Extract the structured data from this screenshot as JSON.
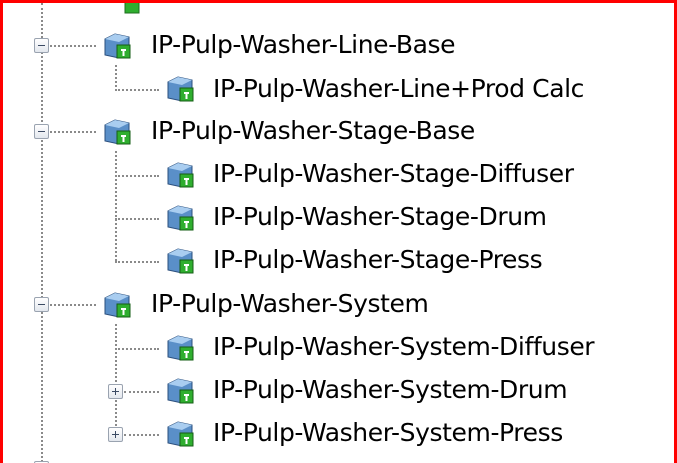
{
  "tree": {
    "nodes": [
      {
        "label": "IP-Pulp-Washer-Line-Base",
        "level": 1,
        "expander": "collapse"
      },
      {
        "label": "IP-Pulp-Washer-Line+Prod Calc",
        "level": 2,
        "expander": "none"
      },
      {
        "label": "IP-Pulp-Washer-Stage-Base",
        "level": 1,
        "expander": "collapse"
      },
      {
        "label": "IP-Pulp-Washer-Stage-Diffuser",
        "level": 2,
        "expander": "none"
      },
      {
        "label": "IP-Pulp-Washer-Stage-Drum",
        "level": 2,
        "expander": "none"
      },
      {
        "label": "IP-Pulp-Washer-Stage-Press",
        "level": 2,
        "expander": "none"
      },
      {
        "label": "IP-Pulp-Washer-System",
        "level": 1,
        "expander": "collapse"
      },
      {
        "label": "IP-Pulp-Washer-System-Diffuser",
        "level": 2,
        "expander": "none"
      },
      {
        "label": "IP-Pulp-Washer-System-Drum",
        "level": 2,
        "expander": "expand"
      },
      {
        "label": "IP-Pulp-Washer-System-Press",
        "level": 2,
        "expander": "expand"
      }
    ]
  },
  "icons": {
    "node_icon": "class-template-icon",
    "icon_colors": {
      "cube": "#5a8fc8",
      "badge": "#2fae2f"
    }
  },
  "colors": {
    "frame_border": "#ff0000",
    "tree_lines": "#8a8a8a"
  }
}
